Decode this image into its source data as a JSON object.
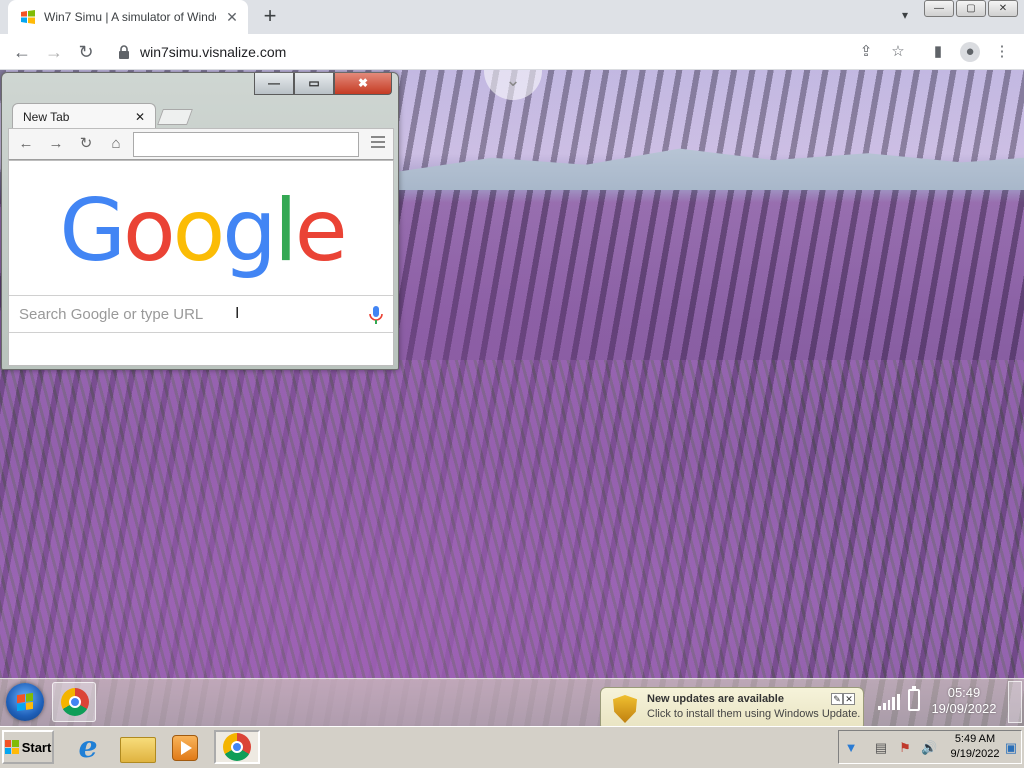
{
  "host_browser": {
    "tab_title": "Win7 Simu | A simulator of Window",
    "tab_close": "✕",
    "new_tab": "+",
    "url": "win7simu.visnalize.com",
    "window_controls": [
      "—",
      "▢",
      "✕"
    ],
    "icons": [
      "back-icon",
      "forward-icon",
      "reload-icon",
      "lock-icon",
      "share-icon",
      "star-icon",
      "sidepanel-icon",
      "profile-icon",
      "menu-icon"
    ]
  },
  "desktop": {
    "pull_indicator": "⌄"
  },
  "inner_browser": {
    "window_controls": {
      "minimize": "—",
      "maximize": "▭",
      "close": "✖"
    },
    "tab_title": "New Tab",
    "tab_close": "✕",
    "omnibox_value": "",
    "google_letters": [
      "G",
      "o",
      "o",
      "g",
      "l",
      "e"
    ],
    "search_placeholder": "Search Google or type URL",
    "cursor": "I"
  },
  "upper_taskbar": {
    "notification": {
      "title": "New updates are available",
      "message": "Click to install them using Windows Update."
    },
    "clock_time": "05:49",
    "clock_date": "19/09/2022"
  },
  "lower_taskbar": {
    "start_label": "Start",
    "ie_glyph": "e",
    "clock_time": "5:49 AM",
    "clock_date": "9/19/2022"
  },
  "colors": {
    "google_blue": "#4285f4",
    "google_red": "#ea4335",
    "google_yellow": "#fbbc05",
    "google_green": "#34a853",
    "close_red": "#c53b23"
  }
}
